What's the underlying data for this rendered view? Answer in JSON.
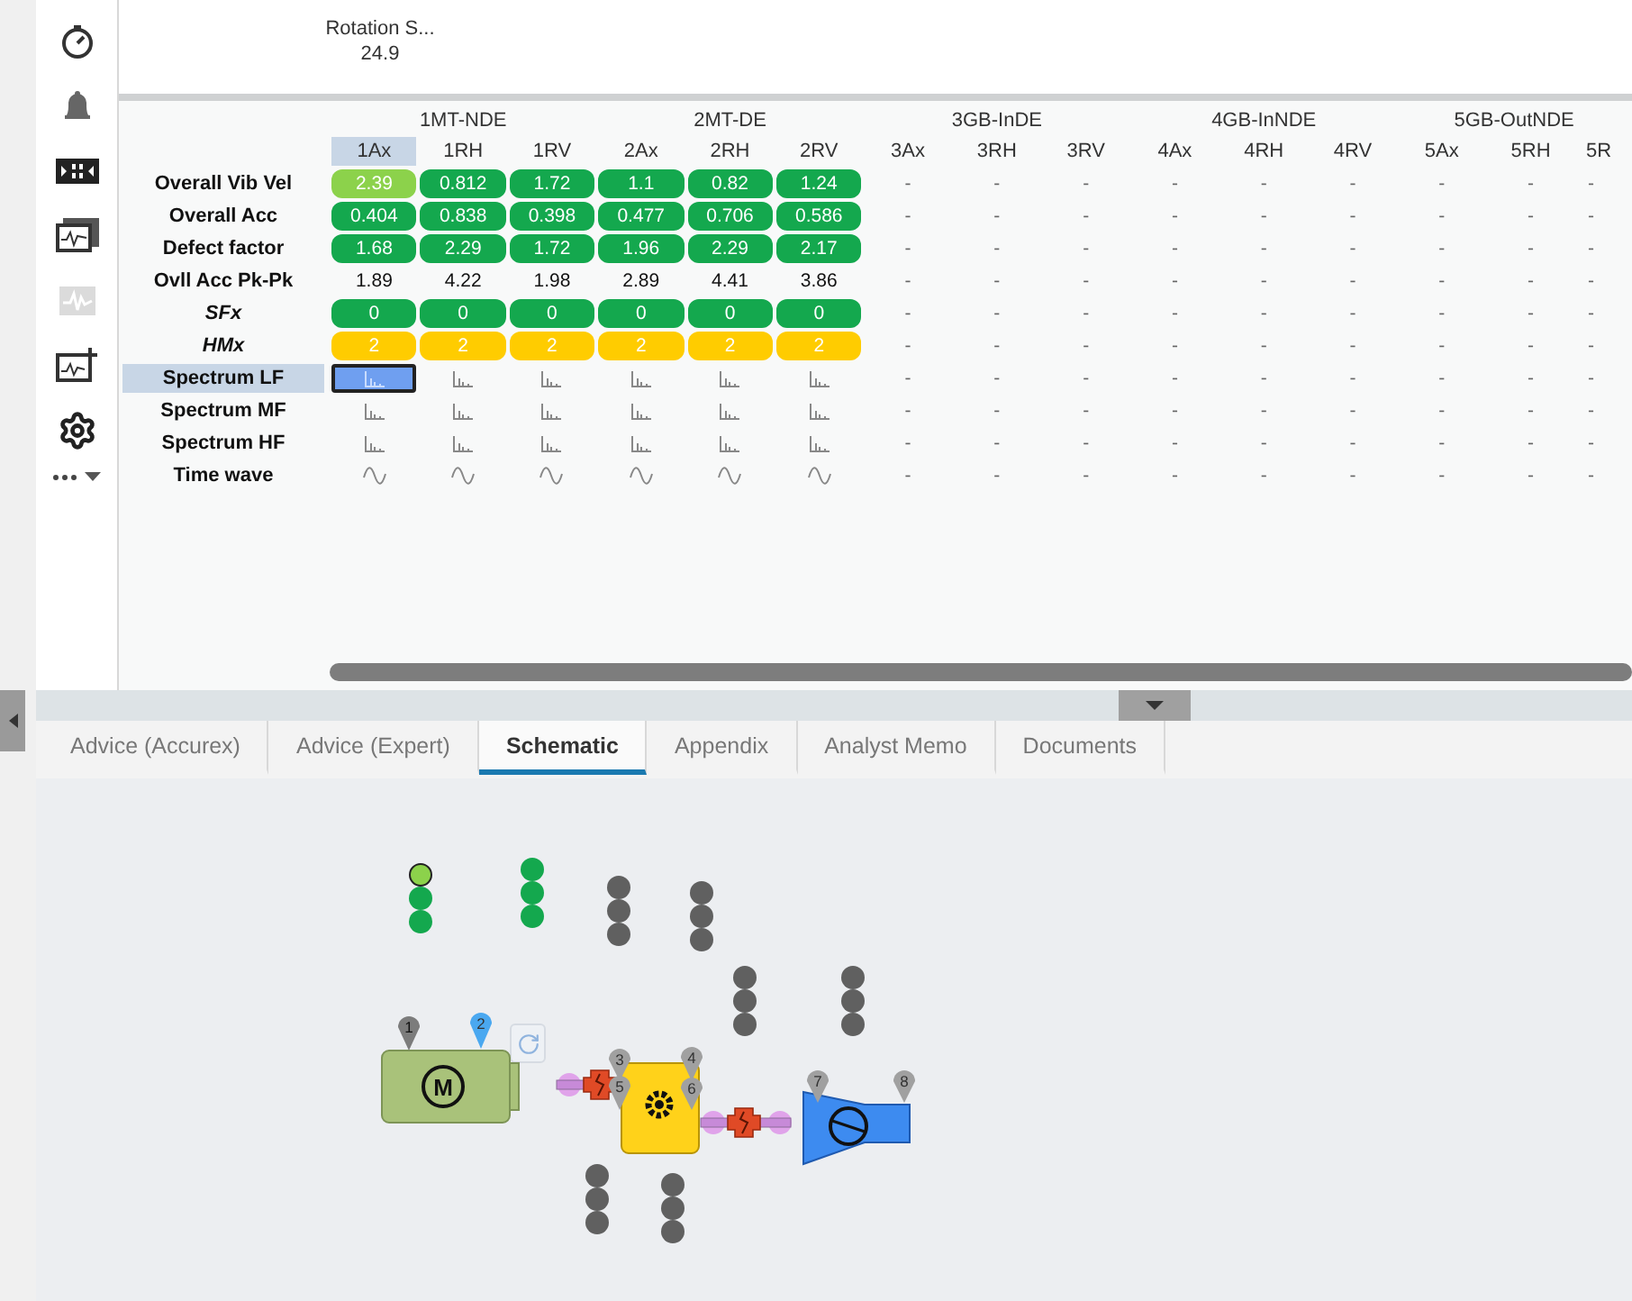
{
  "sidebar": {
    "items": [
      {
        "disabled": false
      },
      {
        "disabled": false
      },
      {
        "disabled": false
      },
      {
        "disabled": false
      },
      {
        "disabled": true
      },
      {
        "disabled": false
      },
      {
        "disabled": false
      }
    ]
  },
  "rotation": {
    "label": "Rotation S...",
    "value": "24.9"
  },
  "table": {
    "groups": [
      "1MT-NDE",
      "2MT-DE",
      "3GB-InDE",
      "4GB-InNDE",
      "5GB-OutNDE"
    ],
    "columns": [
      {
        "label": "1Ax",
        "selected": true
      },
      {
        "label": "1RH",
        "selected": false
      },
      {
        "label": "1RV",
        "selected": false
      },
      {
        "label": "2Ax",
        "selected": false
      },
      {
        "label": "2RH",
        "selected": false
      },
      {
        "label": "2RV",
        "selected": false
      },
      {
        "label": "3Ax",
        "selected": false
      },
      {
        "label": "3RH",
        "selected": false
      },
      {
        "label": "3RV",
        "selected": false
      },
      {
        "label": "4Ax",
        "selected": false
      },
      {
        "label": "4RH",
        "selected": false
      },
      {
        "label": "4RV",
        "selected": false
      },
      {
        "label": "5Ax",
        "selected": false
      },
      {
        "label": "5RH",
        "selected": false
      },
      {
        "label": "5R",
        "selected": false
      }
    ],
    "rows": [
      {
        "label": "Overall Vib Vel",
        "italic": false,
        "selected": false,
        "cells": [
          {
            "kind": "badge",
            "text": "2.39",
            "color": "#8cd24b"
          },
          {
            "kind": "badge",
            "text": "0.812",
            "color": "#14a84e"
          },
          {
            "kind": "badge",
            "text": "1.72",
            "color": "#14a84e"
          },
          {
            "kind": "badge",
            "text": "1.1",
            "color": "#14a84e"
          },
          {
            "kind": "badge",
            "text": "0.82",
            "color": "#14a84e"
          },
          {
            "kind": "badge",
            "text": "1.24",
            "color": "#14a84e"
          },
          {
            "kind": "dash",
            "text": "-"
          },
          {
            "kind": "dash",
            "text": "-"
          },
          {
            "kind": "dash",
            "text": "-"
          },
          {
            "kind": "dash",
            "text": "-"
          },
          {
            "kind": "dash",
            "text": "-"
          },
          {
            "kind": "dash",
            "text": "-"
          },
          {
            "kind": "dash",
            "text": "-"
          },
          {
            "kind": "dash",
            "text": "-"
          },
          {
            "kind": "dash",
            "text": "-"
          }
        ]
      },
      {
        "label": "Overall Acc",
        "italic": false,
        "selected": false,
        "cells": [
          {
            "kind": "badge",
            "text": "0.404",
            "color": "#14a84e"
          },
          {
            "kind": "badge",
            "text": "0.838",
            "color": "#14a84e"
          },
          {
            "kind": "badge",
            "text": "0.398",
            "color": "#14a84e"
          },
          {
            "kind": "badge",
            "text": "0.477",
            "color": "#14a84e"
          },
          {
            "kind": "badge",
            "text": "0.706",
            "color": "#14a84e"
          },
          {
            "kind": "badge",
            "text": "0.586",
            "color": "#14a84e"
          },
          {
            "kind": "dash",
            "text": "-"
          },
          {
            "kind": "dash",
            "text": "-"
          },
          {
            "kind": "dash",
            "text": "-"
          },
          {
            "kind": "dash",
            "text": "-"
          },
          {
            "kind": "dash",
            "text": "-"
          },
          {
            "kind": "dash",
            "text": "-"
          },
          {
            "kind": "dash",
            "text": "-"
          },
          {
            "kind": "dash",
            "text": "-"
          },
          {
            "kind": "dash",
            "text": "-"
          }
        ]
      },
      {
        "label": "Defect factor",
        "italic": false,
        "selected": false,
        "cells": [
          {
            "kind": "badge",
            "text": "1.68",
            "color": "#14a84e"
          },
          {
            "kind": "badge",
            "text": "2.29",
            "color": "#14a84e"
          },
          {
            "kind": "badge",
            "text": "1.72",
            "color": "#14a84e"
          },
          {
            "kind": "badge",
            "text": "1.96",
            "color": "#14a84e"
          },
          {
            "kind": "badge",
            "text": "2.29",
            "color": "#14a84e"
          },
          {
            "kind": "badge",
            "text": "2.17",
            "color": "#14a84e"
          },
          {
            "kind": "dash",
            "text": "-"
          },
          {
            "kind": "dash",
            "text": "-"
          },
          {
            "kind": "dash",
            "text": "-"
          },
          {
            "kind": "dash",
            "text": "-"
          },
          {
            "kind": "dash",
            "text": "-"
          },
          {
            "kind": "dash",
            "text": "-"
          },
          {
            "kind": "dash",
            "text": "-"
          },
          {
            "kind": "dash",
            "text": "-"
          },
          {
            "kind": "dash",
            "text": "-"
          }
        ]
      },
      {
        "label": "Ovll Acc Pk-Pk",
        "italic": false,
        "selected": false,
        "cells": [
          {
            "kind": "text",
            "text": "1.89"
          },
          {
            "kind": "text",
            "text": "4.22"
          },
          {
            "kind": "text",
            "text": "1.98"
          },
          {
            "kind": "text",
            "text": "2.89"
          },
          {
            "kind": "text",
            "text": "4.41"
          },
          {
            "kind": "text",
            "text": "3.86"
          },
          {
            "kind": "dash",
            "text": "-"
          },
          {
            "kind": "dash",
            "text": "-"
          },
          {
            "kind": "dash",
            "text": "-"
          },
          {
            "kind": "dash",
            "text": "-"
          },
          {
            "kind": "dash",
            "text": "-"
          },
          {
            "kind": "dash",
            "text": "-"
          },
          {
            "kind": "dash",
            "text": "-"
          },
          {
            "kind": "dash",
            "text": "-"
          },
          {
            "kind": "dash",
            "text": "-"
          }
        ]
      },
      {
        "label": "SFx",
        "italic": true,
        "selected": false,
        "cells": [
          {
            "kind": "badge",
            "text": "0",
            "color": "#14a84e"
          },
          {
            "kind": "badge",
            "text": "0",
            "color": "#14a84e"
          },
          {
            "kind": "badge",
            "text": "0",
            "color": "#14a84e"
          },
          {
            "kind": "badge",
            "text": "0",
            "color": "#14a84e"
          },
          {
            "kind": "badge",
            "text": "0",
            "color": "#14a84e"
          },
          {
            "kind": "badge",
            "text": "0",
            "color": "#14a84e"
          },
          {
            "kind": "dash",
            "text": "-"
          },
          {
            "kind": "dash",
            "text": "-"
          },
          {
            "kind": "dash",
            "text": "-"
          },
          {
            "kind": "dash",
            "text": "-"
          },
          {
            "kind": "dash",
            "text": "-"
          },
          {
            "kind": "dash",
            "text": "-"
          },
          {
            "kind": "dash",
            "text": "-"
          },
          {
            "kind": "dash",
            "text": "-"
          },
          {
            "kind": "dash",
            "text": "-"
          }
        ]
      },
      {
        "label": "HMx",
        "italic": true,
        "selected": false,
        "cells": [
          {
            "kind": "badge",
            "text": "2",
            "color": "#ffcc00"
          },
          {
            "kind": "badge",
            "text": "2",
            "color": "#ffcc00"
          },
          {
            "kind": "badge",
            "text": "2",
            "color": "#ffcc00"
          },
          {
            "kind": "badge",
            "text": "2",
            "color": "#ffcc00"
          },
          {
            "kind": "badge",
            "text": "2",
            "color": "#ffcc00"
          },
          {
            "kind": "badge",
            "text": "2",
            "color": "#ffcc00"
          },
          {
            "kind": "dash",
            "text": "-"
          },
          {
            "kind": "dash",
            "text": "-"
          },
          {
            "kind": "dash",
            "text": "-"
          },
          {
            "kind": "dash",
            "text": "-"
          },
          {
            "kind": "dash",
            "text": "-"
          },
          {
            "kind": "dash",
            "text": "-"
          },
          {
            "kind": "dash",
            "text": "-"
          },
          {
            "kind": "dash",
            "text": "-"
          },
          {
            "kind": "dash",
            "text": "-"
          }
        ]
      },
      {
        "label": "Spectrum LF",
        "italic": false,
        "selected": true,
        "cells": [
          {
            "kind": "spectrum"
          },
          {
            "kind": "spectrum"
          },
          {
            "kind": "spectrum"
          },
          {
            "kind": "spectrum"
          },
          {
            "kind": "spectrum"
          },
          {
            "kind": "spectrum"
          },
          {
            "kind": "dash",
            "text": "-"
          },
          {
            "kind": "dash",
            "text": "-"
          },
          {
            "kind": "dash",
            "text": "-"
          },
          {
            "kind": "dash",
            "text": "-"
          },
          {
            "kind": "dash",
            "text": "-"
          },
          {
            "kind": "dash",
            "text": "-"
          },
          {
            "kind": "dash",
            "text": "-"
          },
          {
            "kind": "dash",
            "text": "-"
          },
          {
            "kind": "dash",
            "text": "-"
          }
        ]
      },
      {
        "label": "Spectrum MF",
        "italic": false,
        "selected": false,
        "cells": [
          {
            "kind": "spectrum"
          },
          {
            "kind": "spectrum"
          },
          {
            "kind": "spectrum"
          },
          {
            "kind": "spectrum"
          },
          {
            "kind": "spectrum"
          },
          {
            "kind": "spectrum"
          },
          {
            "kind": "dash",
            "text": "-"
          },
          {
            "kind": "dash",
            "text": "-"
          },
          {
            "kind": "dash",
            "text": "-"
          },
          {
            "kind": "dash",
            "text": "-"
          },
          {
            "kind": "dash",
            "text": "-"
          },
          {
            "kind": "dash",
            "text": "-"
          },
          {
            "kind": "dash",
            "text": "-"
          },
          {
            "kind": "dash",
            "text": "-"
          },
          {
            "kind": "dash",
            "text": "-"
          }
        ]
      },
      {
        "label": "Spectrum HF",
        "italic": false,
        "selected": false,
        "cells": [
          {
            "kind": "spectrum"
          },
          {
            "kind": "spectrum"
          },
          {
            "kind": "spectrum"
          },
          {
            "kind": "spectrum"
          },
          {
            "kind": "spectrum"
          },
          {
            "kind": "spectrum"
          },
          {
            "kind": "dash",
            "text": "-"
          },
          {
            "kind": "dash",
            "text": "-"
          },
          {
            "kind": "dash",
            "text": "-"
          },
          {
            "kind": "dash",
            "text": "-"
          },
          {
            "kind": "dash",
            "text": "-"
          },
          {
            "kind": "dash",
            "text": "-"
          },
          {
            "kind": "dash",
            "text": "-"
          },
          {
            "kind": "dash",
            "text": "-"
          },
          {
            "kind": "dash",
            "text": "-"
          }
        ]
      },
      {
        "label": "Time wave",
        "italic": false,
        "selected": false,
        "cells": [
          {
            "kind": "wave"
          },
          {
            "kind": "wave"
          },
          {
            "kind": "wave"
          },
          {
            "kind": "wave"
          },
          {
            "kind": "wave"
          },
          {
            "kind": "wave"
          },
          {
            "kind": "dash",
            "text": "-"
          },
          {
            "kind": "dash",
            "text": "-"
          },
          {
            "kind": "dash",
            "text": "-"
          },
          {
            "kind": "dash",
            "text": "-"
          },
          {
            "kind": "dash",
            "text": "-"
          },
          {
            "kind": "dash",
            "text": "-"
          },
          {
            "kind": "dash",
            "text": "-"
          },
          {
            "kind": "dash",
            "text": "-"
          },
          {
            "kind": "dash",
            "text": "-"
          }
        ]
      }
    ]
  },
  "tabs": [
    {
      "label": "Advice (Accurex)",
      "selected": false
    },
    {
      "label": "Advice (Expert)",
      "selected": false
    },
    {
      "label": "Schematic",
      "selected": true
    },
    {
      "label": "Appendix",
      "selected": false
    },
    {
      "label": "Analyst Memo",
      "selected": false
    },
    {
      "label": "Documents",
      "selected": false
    }
  ],
  "schematic": {
    "dot_groups": [
      {
        "dots": [
          {
            "color": "#8cd24b"
          },
          {
            "color": "#14a84e"
          },
          {
            "color": "#14a84e"
          }
        ]
      },
      {
        "dots": [
          {
            "color": "#14a84e"
          },
          {
            "color": "#14a84e"
          },
          {
            "color": "#14a84e"
          }
        ]
      },
      {
        "dots": [
          {
            "color": "#606060"
          },
          {
            "color": "#606060"
          },
          {
            "color": "#606060"
          }
        ]
      },
      {
        "dots": [
          {
            "color": "#606060"
          },
          {
            "color": "#606060"
          },
          {
            "color": "#606060"
          }
        ]
      },
      {
        "dots": [
          {
            "color": "#606060"
          },
          {
            "color": "#606060"
          },
          {
            "color": "#606060"
          }
        ]
      },
      {
        "dots": [
          {
            "color": "#606060"
          },
          {
            "color": "#606060"
          },
          {
            "color": "#606060"
          }
        ]
      },
      {
        "dots": [
          {
            "color": "#606060"
          },
          {
            "color": "#606060"
          },
          {
            "color": "#606060"
          }
        ]
      },
      {
        "dots": [
          {
            "color": "#606060"
          },
          {
            "color": "#606060"
          },
          {
            "color": "#606060"
          }
        ]
      }
    ],
    "motor_label": "M",
    "pins": [
      {
        "label": "1",
        "color": "#7c7c7c"
      },
      {
        "label": "2",
        "color": "#4aa8f0"
      },
      {
        "label": "3",
        "color": "#a0a0a0"
      },
      {
        "label": "4",
        "color": "#a0a0a0"
      },
      {
        "label": "5",
        "color": "#a0a0a0"
      },
      {
        "label": "6",
        "color": "#a0a0a0"
      },
      {
        "label": "7",
        "color": "#a0a0a0"
      },
      {
        "label": "8",
        "color": "#a0a0a0"
      }
    ]
  }
}
